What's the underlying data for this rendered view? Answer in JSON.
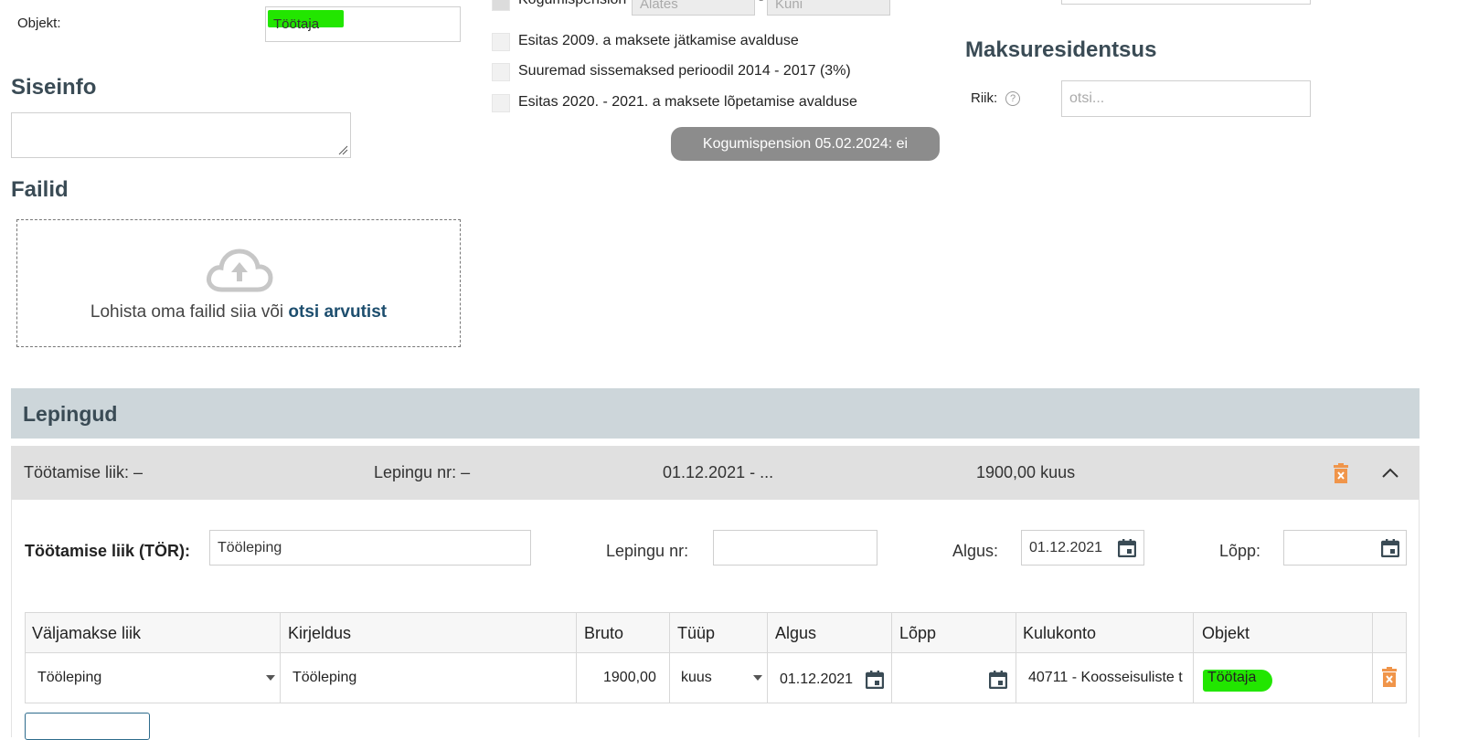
{
  "top_left": {
    "objekt_label": "Objekt:",
    "objekt_value": "Töötaja"
  },
  "siseinfo": {
    "title": "Siseinfo"
  },
  "failid": {
    "title": "Failid",
    "drop_text": "Lohista oma failid siia või ",
    "drop_link": "otsi arvutist"
  },
  "pension": {
    "row0_label": "Kogumispension",
    "from_placeholder": "Alates",
    "dash": "-",
    "to_placeholder": "Kuni",
    "checkboxes": [
      "Esitas 2009. a maksete jätkamise avalduse",
      "Suuremad sissemaksed perioodil 2014 - 2017 (3%)",
      "Esitas 2020. - 2021. a maksete lõpetamise avalduse"
    ],
    "status_button": "Kogumispension 05.02.2024: ei"
  },
  "maksuresidentsus": {
    "title": "Maksuresidentsus",
    "riik_label": "Riik:",
    "riik_placeholder": "otsi..."
  },
  "lepingud": {
    "title": "Lepingud",
    "summary": {
      "tootamise_liik": "Töötamise liik: –",
      "lepingu_nr": "Lepingu nr: –",
      "period": "01.12.2021 - ...",
      "amount": "1900,00 kuus"
    },
    "form": {
      "tootamise_liik_label": "Töötamise liik (TÖR):",
      "tootamise_liik_value": "Tööleping",
      "lepingu_nr_label": "Lepingu nr:",
      "lepingu_nr_value": "",
      "algus_label": "Algus:",
      "algus_value": "01.12.2021",
      "lopp_label": "Lõpp:",
      "lopp_value": ""
    },
    "table": {
      "headers": [
        "Väljamakse liik",
        "Kirjeldus",
        "Bruto",
        "Tüüp",
        "Algus",
        "Lõpp",
        "Kulukonto",
        "Objekt"
      ],
      "row": {
        "valjamakse_liik": "Tööleping",
        "kirjeldus": "Tööleping",
        "bruto": "1900,00",
        "tyyp": "kuus",
        "algus": "01.12.2021",
        "lopp": "",
        "kulukonto": "40711 - Koosseisuliste t",
        "objekt": "Töötaja"
      }
    }
  },
  "icons": {
    "upload": "cloud-upload-icon",
    "calendar": "calendar-icon",
    "trash": "trash-icon",
    "collapse": "chevron-up-icon",
    "dropdown": "caret-down-icon",
    "help": "help-circle-icon"
  },
  "colors": {
    "highlight": "#22e600",
    "section_title": "#3a4b55",
    "lepingud_bar": "#cdd6da",
    "summary_bar": "#e0e0e0",
    "trash": "#f0954a",
    "link": "#1d4e6e",
    "status_pill": "#8c8c8c"
  }
}
